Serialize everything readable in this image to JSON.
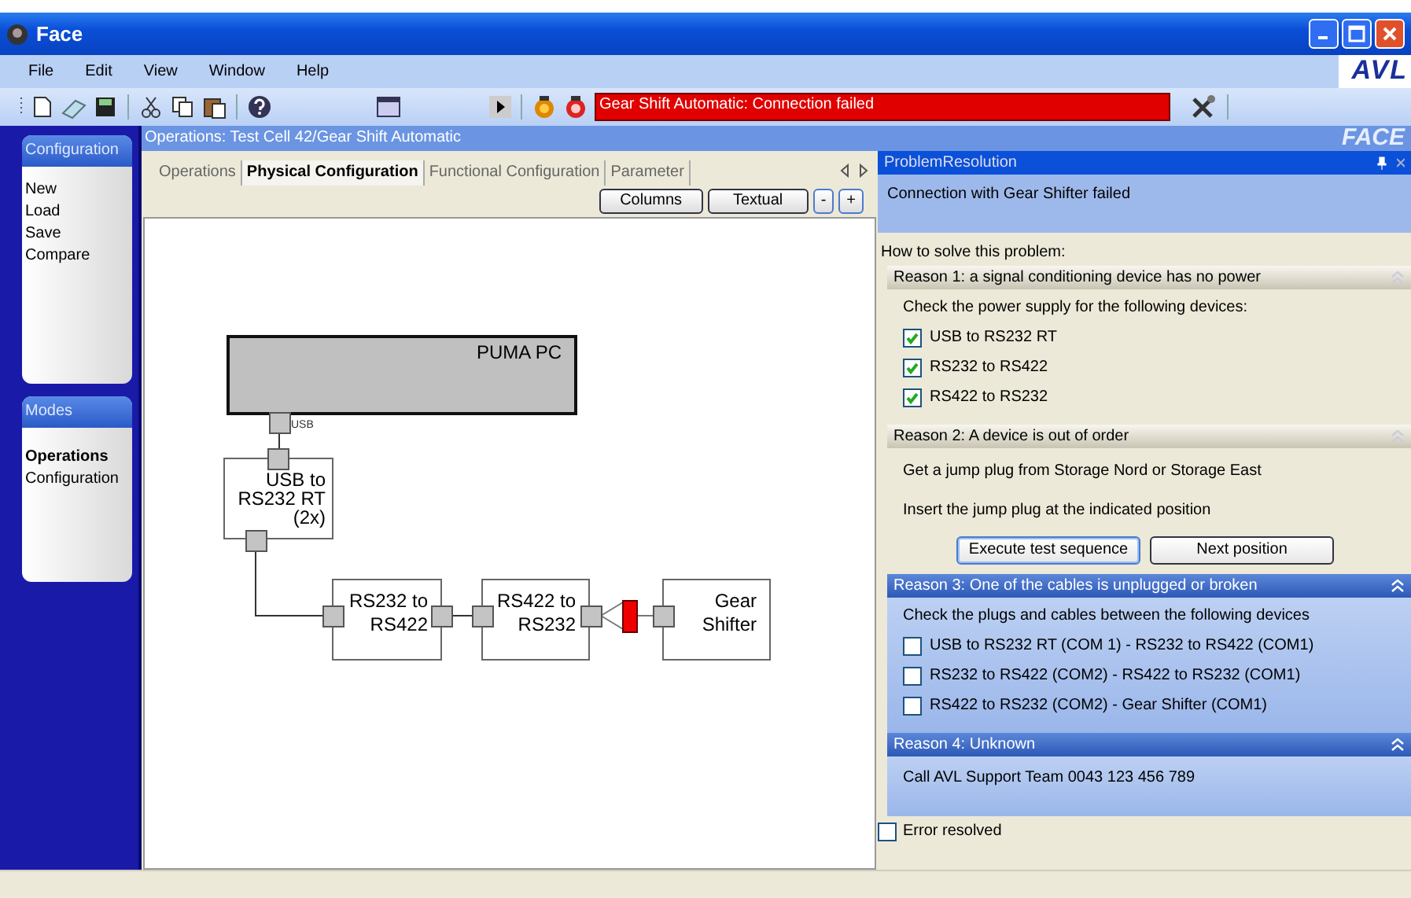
{
  "window": {
    "title": "Face"
  },
  "menu": [
    "File",
    "Edit",
    "View",
    "Window",
    "Help"
  ],
  "logo": "AVL",
  "toolbar": {
    "status_message": "Gear Shift Automatic: Connection failed"
  },
  "sidebar": {
    "panels": [
      {
        "title": "Configuration",
        "items": [
          {
            "label": "New",
            "selected": false
          },
          {
            "label": "Load",
            "selected": false
          },
          {
            "label": "Save",
            "selected": false
          },
          {
            "label": "Compare",
            "selected": false
          }
        ]
      },
      {
        "title": "Modes",
        "items": [
          {
            "label": "Operations",
            "selected": true
          },
          {
            "label": "Configuration",
            "selected": false
          }
        ]
      }
    ]
  },
  "document": {
    "title": "Operations: Test Cell 42/Gear Shift Automatic",
    "brand": "FACE",
    "tabs": [
      {
        "label": "Operations",
        "selected": false
      },
      {
        "label": "Physical Configuration",
        "selected": true
      },
      {
        "label": "Functional Configuration",
        "selected": false
      },
      {
        "label": "Parameter",
        "selected": false
      }
    ],
    "buttons": [
      "Columns",
      "Textual",
      "-",
      "+"
    ],
    "diagram": {
      "nodes": [
        {
          "kind": "computer",
          "lines": [
            "PUMA PC"
          ],
          "port_label": "USB"
        },
        {
          "kind": "device",
          "lines": [
            "USB to",
            "RS232 RT",
            "(2x)"
          ]
        },
        {
          "kind": "device",
          "lines": [
            "RS232 to",
            "RS422"
          ]
        },
        {
          "kind": "device",
          "lines": [
            "RS422 to",
            "RS232"
          ]
        },
        {
          "kind": "device",
          "lines": [
            "Gear",
            "Shifter"
          ]
        }
      ]
    }
  },
  "problem_panel": {
    "title": "ProblemResolution",
    "message": "Connection with Gear Shifter failed",
    "intro": "How to solve this problem:",
    "reasons": [
      {
        "title": "Reason 1: a signal conditioning device has no power",
        "highlighted": false,
        "items": [
          {
            "kind": "text",
            "text": "Check the power supply for the following devices:"
          },
          {
            "kind": "checkbox",
            "label": "USB to RS232 RT",
            "checked": true
          },
          {
            "kind": "checkbox",
            "label": "RS232 to RS422",
            "checked": true
          },
          {
            "kind": "checkbox",
            "label": "RS422 to RS232",
            "checked": true
          }
        ]
      },
      {
        "title": "Reason 2: A device is out of order",
        "highlighted": false,
        "items": [
          {
            "kind": "text",
            "text": "Get a jump plug from Storage Nord or Storage East"
          },
          {
            "kind": "text",
            "text": "Insert the jump plug at the indicated position"
          },
          {
            "kind": "buttons",
            "buttons": [
              "Execute test sequence",
              "Next position"
            ]
          }
        ]
      },
      {
        "title": "Reason 3: One of the cables is unplugged or broken",
        "highlighted": true,
        "items": [
          {
            "kind": "text",
            "text": "Check the plugs and cables between the following devices"
          },
          {
            "kind": "checkbox",
            "label": "USB to RS232 RT (COM 1) - RS232 to RS422 (COM1)",
            "checked": false
          },
          {
            "kind": "checkbox",
            "label": "RS232 to RS422 (COM2) - RS422 to RS232 (COM1)",
            "checked": false
          },
          {
            "kind": "checkbox",
            "label": "RS422 to RS232 (COM2) - Gear Shifter (COM1)",
            "checked": false
          }
        ]
      },
      {
        "title": "Reason 4: Unknown",
        "highlighted": true,
        "items": [
          {
            "kind": "text",
            "text": "Call AVL Support Team 0043 123 456 789"
          }
        ]
      }
    ],
    "resolved": {
      "label": "Error resolved",
      "checked": false
    }
  }
}
